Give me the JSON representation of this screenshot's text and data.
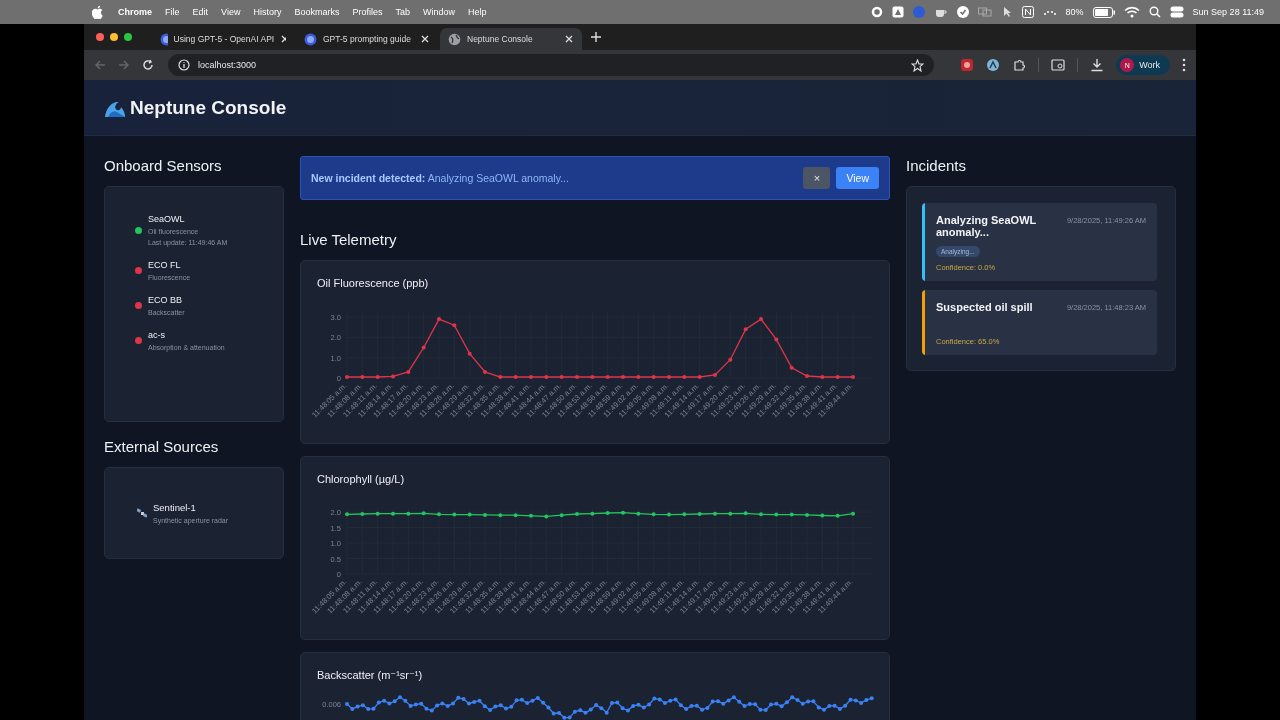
{
  "menu_bar": {
    "app": "Chrome",
    "menus": [
      "File",
      "Edit",
      "View",
      "History",
      "Bookmarks",
      "Profiles",
      "Tab",
      "Window",
      "Help"
    ],
    "battery": "80%",
    "clock": "Sun Sep 28  11:49"
  },
  "browser": {
    "tabs": [
      {
        "title": "Using GPT-5 - OpenAI API",
        "selected": false
      },
      {
        "title": "GPT-5 prompting guide",
        "selected": false
      },
      {
        "title": "Neptune Console",
        "selected": true
      }
    ],
    "url": "localhost:3000",
    "profile": {
      "initial": "N",
      "name": "Work"
    }
  },
  "app": {
    "title": "Neptune Console"
  },
  "onboard_sensors": {
    "title": "Onboard Sensors",
    "items": [
      {
        "name": "SeaOWL",
        "description": "Oil fluorescence",
        "color": "#22c55e",
        "last_update": "Last update: 11:49:46 AM"
      },
      {
        "name": "ECO FL",
        "description": "Fluorescence",
        "color": "#e0344a"
      },
      {
        "name": "ECO BB",
        "description": "Backscatter",
        "color": "#e0344a"
      },
      {
        "name": "ac-s",
        "description": "Absorption & attenuation",
        "color": "#e0344a"
      }
    ]
  },
  "external_sources": {
    "title": "External Sources",
    "items": [
      {
        "name": "Sentinel-1",
        "description": "Synthetic aperture radar"
      }
    ]
  },
  "banner": {
    "text": "**New incident detected:** Analyzing SeaOWL anomaly...",
    "close": "×",
    "action": "View"
  },
  "telemetry": {
    "title": "Live Telemetry",
    "charts": [
      {
        "kind": "line_chart",
        "title": "Oil Fluorescence (ppb)",
        "chart_data": {
          "type": "line",
          "categories": [
            "11:48:05 a.m.",
            "11:48:08 a.m.",
            "11:48:11 a.m.",
            "11:48:14 a.m.",
            "11:48:17 a.m.",
            "11:48:20 a.m.",
            "11:48:23 a.m.",
            "11:48:26 a.m.",
            "11:48:29 a.m.",
            "11:48:32 a.m.",
            "11:48:35 a.m.",
            "11:48:38 a.m.",
            "11:48:41 a.m.",
            "11:48:44 a.m.",
            "11:48:47 a.m.",
            "11:48:50 a.m.",
            "11:48:53 a.m.",
            "11:48:56 a.m.",
            "11:48:59 a.m.",
            "11:49:02 a.m.",
            "11:49:05 a.m.",
            "11:49:08 a.m.",
            "11:49:11 a.m.",
            "11:49:14 a.m.",
            "11:49:17 a.m.",
            "11:49:20 a.m.",
            "11:49:23 a.m.",
            "11:49:26 a.m.",
            "11:49:29 a.m.",
            "11:49:32 a.m.",
            "11:49:35 a.m.",
            "11:49:38 a.m.",
            "11:49:41 a.m.",
            "11:49:44 a.m."
          ],
          "series": [
            {
              "color": "#e0344a",
              "values": [
                0.05,
                0.05,
                0.05,
                0.08,
                0.3,
                1.5,
                2.9,
                2.6,
                1.2,
                0.3,
                0.05,
                0.05,
                0.05,
                0.05,
                0.05,
                0.05,
                0.05,
                0.05,
                0.05,
                0.05,
                0.05,
                0.05,
                0.05,
                0.05,
                0.15,
                0.9,
                2.4,
                2.9,
                1.9,
                0.5,
                0.1,
                0.05,
                0.05,
                0.05
              ]
            }
          ],
          "ylim": [
            0,
            3.2
          ],
          "grid": true,
          "yticks": [
            0,
            {
              "value": 1,
              "label": "1.0"
            },
            {
              "value": 2,
              "label": "2.0"
            },
            {
              "value": 3,
              "label": "3.0"
            }
          ]
        }
      },
      {
        "kind": "line_chart",
        "title": "Chlorophyll (µg/L)",
        "chart_data": {
          "type": "line",
          "categories": [
            "11:48:05 a.m.",
            "11:48:08 a.m.",
            "11:48:11 a.m.",
            "11:48:14 a.m.",
            "11:48:17 a.m.",
            "11:48:20 a.m.",
            "11:48:23 a.m.",
            "11:48:26 a.m.",
            "11:48:29 a.m.",
            "11:48:32 a.m.",
            "11:48:35 a.m.",
            "11:48:38 a.m.",
            "11:48:41 a.m.",
            "11:48:44 a.m.",
            "11:48:47 a.m.",
            "11:48:50 a.m.",
            "11:48:53 a.m.",
            "11:48:56 a.m.",
            "11:48:59 a.m.",
            "11:49:02 a.m.",
            "11:49:05 a.m.",
            "11:49:08 a.m.",
            "11:49:11 a.m.",
            "11:49:14 a.m.",
            "11:49:17 a.m.",
            "11:49:20 a.m.",
            "11:49:23 a.m.",
            "11:49:26 a.m.",
            "11:49:29 a.m.",
            "11:49:32 a.m.",
            "11:49:35 a.m.",
            "11:49:38 a.m.",
            "11:49:41 a.m.",
            "11:49:44 a.m."
          ],
          "series": [
            {
              "color": "#22c55e",
              "values": [
                1.93,
                1.94,
                1.95,
                1.95,
                1.95,
                1.96,
                1.93,
                1.92,
                1.92,
                1.91,
                1.9,
                1.9,
                1.88,
                1.86,
                1.9,
                1.94,
                1.95,
                1.97,
                1.98,
                1.95,
                1.93,
                1.92,
                1.93,
                1.94,
                1.95,
                1.95,
                1.96,
                1.93,
                1.92,
                1.92,
                1.91,
                1.89,
                1.88,
                1.95
              ]
            }
          ],
          "ylim": [
            0,
            2.1
          ],
          "grid": true,
          "yticks": [
            0,
            {
              "value": 0.5,
              "label": "0.5"
            },
            {
              "value": 1,
              "label": "1.0"
            },
            {
              "value": 1.5,
              "label": "1.5"
            },
            {
              "value": 2,
              "label": "2.0"
            }
          ]
        }
      },
      {
        "kind": "sparkline",
        "title": "Backscatter (m⁻¹sr⁻¹)",
        "tick_label": "0.006"
      }
    ]
  },
  "incidents": {
    "title": "Incidents",
    "items": [
      {
        "title": "Analyzing SeaOWL anomaly...",
        "time": "9/28/2025, 11:49:26 AM",
        "badge": "Analyzing...",
        "confidence": "Confidence: 0.0%",
        "color": "#38bdf8"
      },
      {
        "title": "Suspected oil spill",
        "time": "9/28/2025, 11:48:23 AM",
        "confidence": "Confidence: 65.0%",
        "color": "#f59e0b"
      }
    ]
  }
}
